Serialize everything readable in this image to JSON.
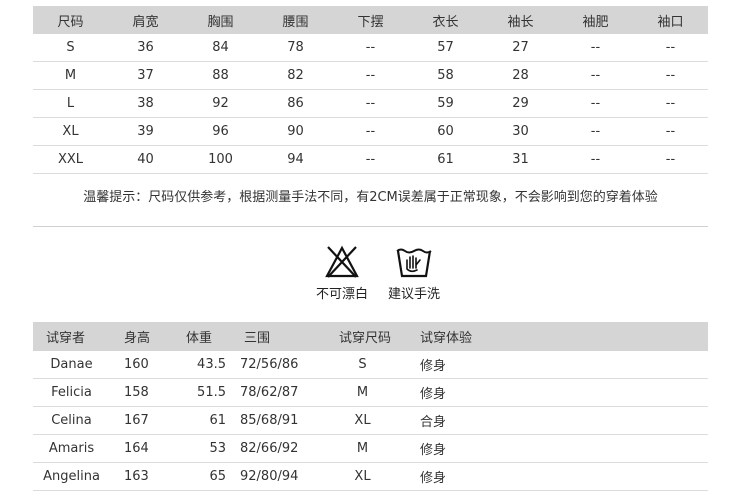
{
  "size_chart": {
    "headers": [
      "尺码",
      "肩宽",
      "胸围",
      "腰围",
      "下摆",
      "衣长",
      "袖长",
      "袖肥",
      "袖口"
    ],
    "rows": [
      [
        "S",
        "36",
        "84",
        "78",
        "--",
        "57",
        "27",
        "--",
        "--"
      ],
      [
        "M",
        "37",
        "88",
        "82",
        "--",
        "58",
        "28",
        "--",
        "--"
      ],
      [
        "L",
        "38",
        "92",
        "86",
        "--",
        "59",
        "29",
        "--",
        "--"
      ],
      [
        "XL",
        "39",
        "96",
        "90",
        "--",
        "60",
        "30",
        "--",
        "--"
      ],
      [
        "XXL",
        "40",
        "100",
        "94",
        "--",
        "61",
        "31",
        "--",
        "--"
      ]
    ]
  },
  "note": "温馨提示：尺码仅供参考，根据测量手法不同，有2CM误差属于正常现象，不会影响到您的穿着体验",
  "care": {
    "no_bleach": {
      "icon": "no-bleach-icon",
      "label": "不可漂白"
    },
    "hand_wash": {
      "icon": "hand-wash-icon",
      "label": "建议手洗"
    }
  },
  "fit_chart": {
    "headers": [
      "试穿者",
      "身高",
      "体重",
      "三围",
      "试穿尺码",
      "试穿体验"
    ],
    "rows": [
      [
        "Danae",
        "160",
        "43.5",
        "72/56/86",
        "S",
        "修身"
      ],
      [
        "Felicia",
        "158",
        "51.5",
        "78/62/87",
        "M",
        "修身"
      ],
      [
        "Celina",
        "167",
        "61",
        "85/68/91",
        "XL",
        "合身"
      ],
      [
        "Amaris",
        "164",
        "53",
        "82/66/92",
        "M",
        "修身"
      ],
      [
        "Angelina",
        "163",
        "65",
        "92/80/94",
        "XL",
        "修身"
      ]
    ]
  }
}
